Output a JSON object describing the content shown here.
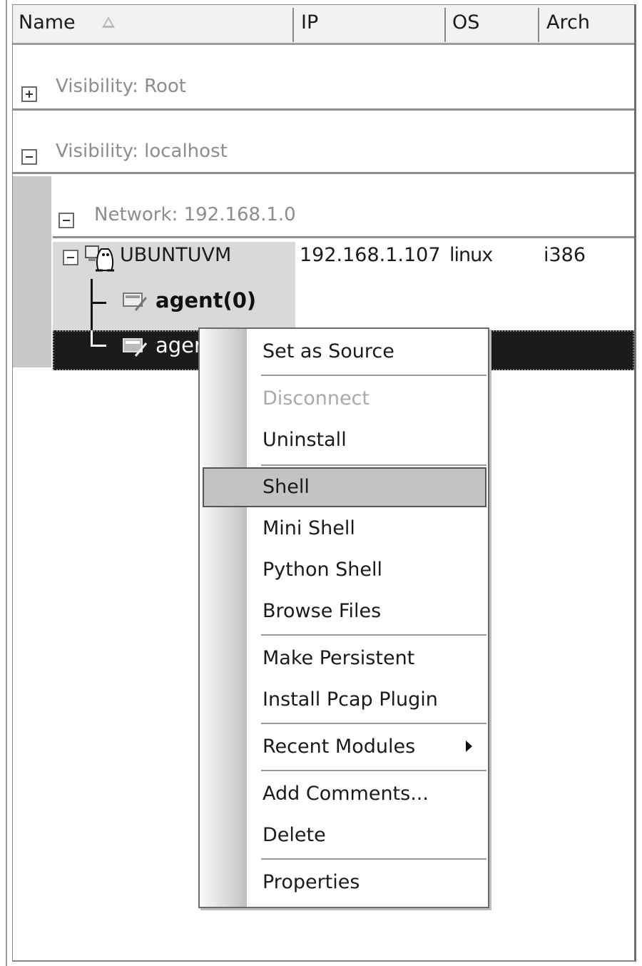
{
  "columns": {
    "name": "Name",
    "ip": "IP",
    "os": "OS",
    "arch": "Arch"
  },
  "groups": {
    "root": "Visibility: Root",
    "localhost": "Visibility: localhost",
    "network": "Network: 192.168.1.0"
  },
  "host": {
    "name": "UBUNTUVM",
    "ip": "192.168.1.107",
    "os": "linux",
    "arch": "i386",
    "os_icon": "linux-penguin-icon"
  },
  "agents": [
    {
      "label": "agent(0)",
      "icon": "agent-icon"
    },
    {
      "label": "agen",
      "icon": "agent-icon",
      "selected": true
    }
  ],
  "context_menu": {
    "items": [
      {
        "label": "Set as Source",
        "enabled": true
      },
      {
        "label": "Disconnect",
        "enabled": false
      },
      {
        "label": "Uninstall",
        "enabled": true
      },
      {
        "label": "Shell",
        "enabled": true,
        "highlighted": true
      },
      {
        "label": "Mini Shell",
        "enabled": true
      },
      {
        "label": "Python Shell",
        "enabled": true
      },
      {
        "label": "Browse Files",
        "enabled": true
      },
      {
        "label": "Make Persistent",
        "enabled": true
      },
      {
        "label": "Install Pcap Plugin",
        "enabled": true
      },
      {
        "label": "Recent Modules",
        "enabled": true,
        "submenu": true
      },
      {
        "label": "Add Comments...",
        "enabled": true
      },
      {
        "label": "Delete",
        "enabled": true
      },
      {
        "label": "Properties",
        "enabled": true
      }
    ]
  },
  "colors": {
    "selection": "#1b1b1b",
    "menu_hover": "#c3c3c3",
    "disabled_text": "#a9a9a9"
  }
}
